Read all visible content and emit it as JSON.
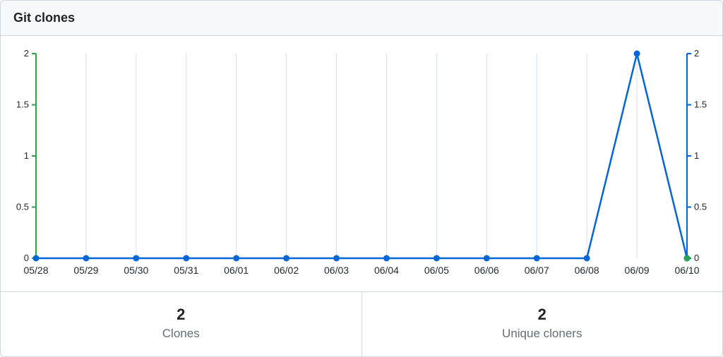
{
  "header": {
    "title": "Git clones"
  },
  "summary": {
    "clones": {
      "value": "2",
      "label": "Clones"
    },
    "uniques": {
      "value": "2",
      "label": "Unique cloners"
    }
  },
  "chart_data": {
    "type": "line",
    "categories": [
      "05/28",
      "05/29",
      "05/30",
      "05/31",
      "06/01",
      "06/02",
      "06/03",
      "06/04",
      "06/05",
      "06/06",
      "06/07",
      "06/08",
      "06/09",
      "06/10"
    ],
    "series": [
      {
        "name": "Clones",
        "color": "#0366d6",
        "values": [
          0,
          0,
          0,
          0,
          0,
          0,
          0,
          0,
          0,
          0,
          0,
          0,
          2,
          0
        ]
      },
      {
        "name": "Unique cloners",
        "color": "#28a745",
        "values": [
          0,
          0,
          0,
          0,
          0,
          0,
          0,
          0,
          0,
          0,
          0,
          0,
          0,
          0
        ]
      }
    ],
    "y_left": {
      "label": "",
      "lim": [
        0,
        2
      ],
      "ticks": [
        0,
        0.5,
        1,
        1.5,
        2
      ],
      "color": "#28a745"
    },
    "y_right": {
      "label": "",
      "lim": [
        0,
        2
      ],
      "ticks": [
        0,
        0.5,
        1,
        1.5,
        2
      ],
      "color": "#0366d6"
    },
    "xlabel": "",
    "ylabel": ""
  }
}
